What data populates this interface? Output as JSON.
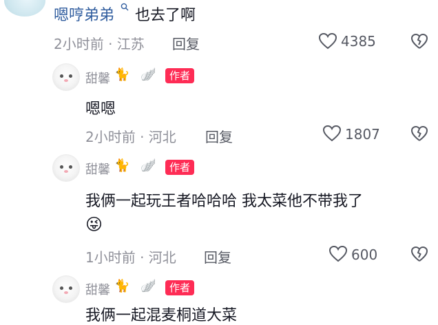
{
  "top_comment": {
    "author": "嗯哼弟弟",
    "text": "也去了啊",
    "time_location": "2小时前 · 江苏",
    "reply_label": "回复",
    "likes": "4385"
  },
  "replies": [
    {
      "username": "甜馨",
      "badge": "作者",
      "text": "嗯嗯",
      "time_location": "2小时前 · 河北",
      "reply_label": "回复",
      "likes": "1807"
    },
    {
      "username": "甜馨",
      "badge": "作者",
      "text": "我俩一起玩王者哈哈哈 我太菜他不带我了",
      "emoji": "😜",
      "time_location": "1小时前 · 河北",
      "reply_label": "回复",
      "likes": "600"
    },
    {
      "username": "甜馨",
      "badge": "作者",
      "text": "我俩一起混麦桐道大菜"
    }
  ],
  "icons": {
    "search": "search-icon",
    "heart": "heart-outline-icon",
    "dislike": "broken-heart-icon",
    "cat": "🐈",
    "wing": "🪽"
  },
  "colors": {
    "badge": "#fe2c55",
    "author_link": "#2f5c9e",
    "meta": "#8f9099"
  }
}
